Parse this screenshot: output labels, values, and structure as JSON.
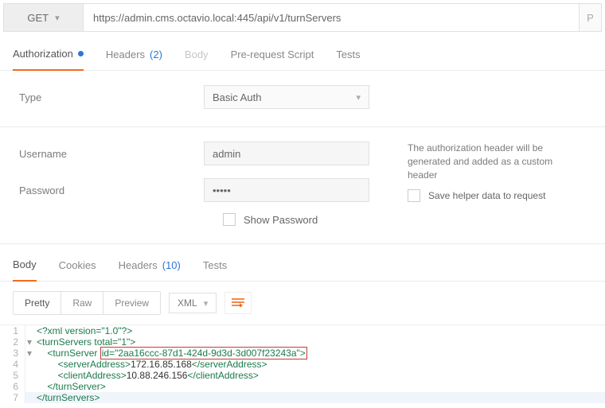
{
  "topbar": {
    "method": "GET",
    "url": "https://admin.cms.octavio.local:445/api/v1/turnServers",
    "params_hint": "P"
  },
  "req_tabs": {
    "auth": "Authorization",
    "headers": "Headers",
    "headers_count": "(2)",
    "body": "Body",
    "prereq": "Pre-request Script",
    "tests": "Tests"
  },
  "auth": {
    "type_label": "Type",
    "type_value": "Basic Auth",
    "username_label": "Username",
    "username_value": "admin",
    "password_label": "Password",
    "password_value": "•••••",
    "show_pw": "Show Password",
    "help_text": "The authorization header will be generated and added as a custom header",
    "save_helper": "Save helper data to request"
  },
  "resp_tabs": {
    "body": "Body",
    "cookies": "Cookies",
    "headers": "Headers",
    "headers_count": "(10)",
    "tests": "Tests"
  },
  "toolbar": {
    "pretty": "Pretty",
    "raw": "Raw",
    "preview": "Preview",
    "format": "XML",
    "wrap": "⇄"
  },
  "xml": {
    "l1": "<?xml version=\"1.0\"?>",
    "l2_open": "<turnServers",
    "l2_attr": " total=\"1\"",
    "l2_close": ">",
    "l3_open": "<turnServer",
    "l3_attr_pre": " ",
    "l3_attr_boxed": "id=\"2aa16ccc-87d1-424d-9d3d-3d007f23243a\">",
    "l4_open": "<serverAddress>",
    "l4_text": "172.16.85.168",
    "l4_close": "</serverAddress>",
    "l5_open": "<clientAddress>",
    "l5_text": "10.88.246.156",
    "l5_close": "</clientAddress>",
    "l6": "</turnServer>",
    "l7": "</turnServers>"
  }
}
